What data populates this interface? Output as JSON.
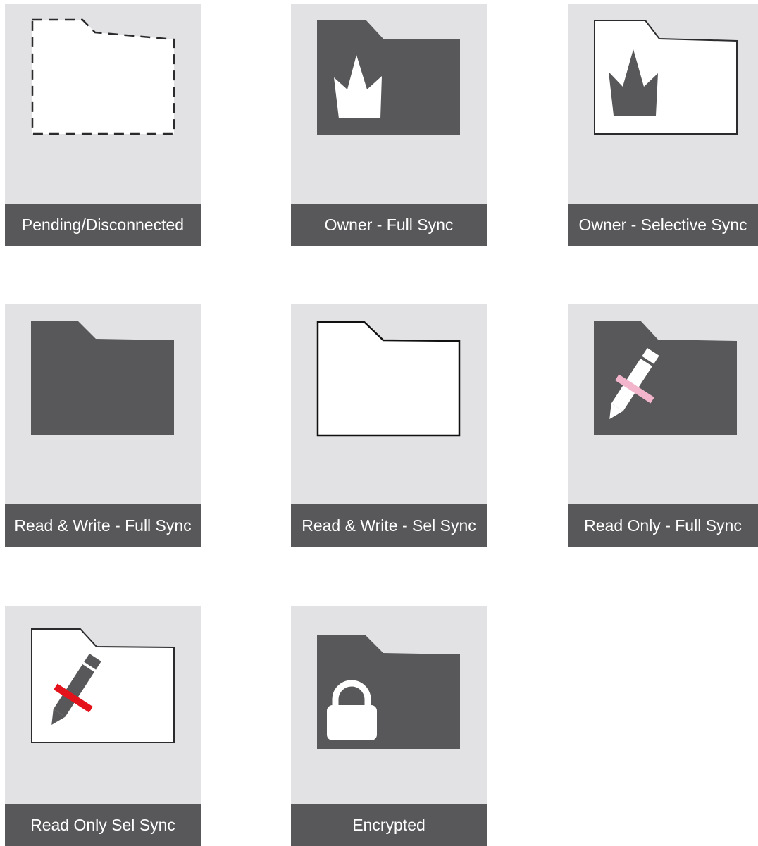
{
  "colors": {
    "tile_background": "#e2e2e4",
    "label_background": "#58585a",
    "folder_dark": "#58585a",
    "folder_light": "#ffffff",
    "pencil_strike_pink": "#f2b5cc",
    "pencil_strike_red": "#e4121b"
  },
  "icons": [
    {
      "label": "Pending/Disconnected",
      "icon": "folder-dashed-outline-icon"
    },
    {
      "label": "Owner - Full Sync",
      "icon": "folder-crown-dark-icon"
    },
    {
      "label": "Owner - Selective Sync",
      "icon": "folder-crown-outline-icon"
    },
    {
      "label": "Read & Write - Full Sync",
      "icon": "folder-dark-icon"
    },
    {
      "label": "Read & Write - Sel Sync",
      "icon": "folder-outline-icon"
    },
    {
      "label": "Read Only - Full Sync",
      "icon": "folder-pencil-strike-dark-icon"
    },
    {
      "label": "Read Only Sel Sync",
      "icon": "folder-pencil-strike-outline-icon"
    },
    {
      "label": "Encrypted",
      "icon": "folder-lock-dark-icon"
    }
  ]
}
